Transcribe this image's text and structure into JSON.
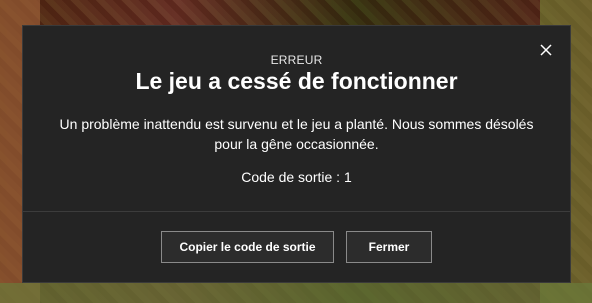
{
  "dialog": {
    "kicker": "ERREUR",
    "title": "Le jeu a cessé de fonctionner",
    "message_line1": "Un problème inattendu est survenu et le jeu a planté. Nous sommes désolés",
    "message_line2": "pour la gêne occasionnée.",
    "exit_code": "Code de sortie : 1",
    "copy_button_label": "Copier le code de sortie",
    "close_button_label": "Fermer",
    "close_icon": "close-icon"
  },
  "colors": {
    "dialog_bg": "#242424",
    "text": "#ffffff",
    "button_border": "#8a8a8a"
  }
}
